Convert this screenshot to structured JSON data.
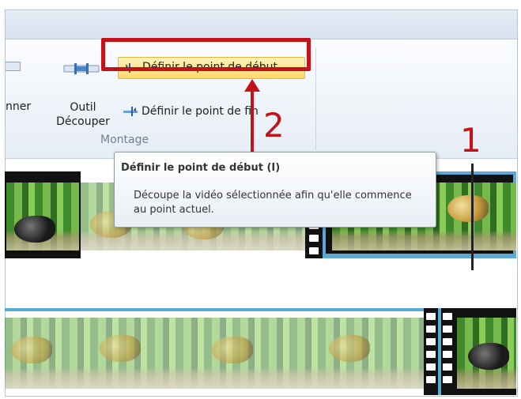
{
  "ribbon": {
    "partial_button_label": "nner",
    "trim_tool_label": "Outil\nDécouper",
    "set_start_label": "Définir le point de début",
    "set_end_label": "Définir le point de fin",
    "group_label": "Montage"
  },
  "tooltip": {
    "title": "Définir le point de début (I)",
    "description": "Découpe la vidéo sélectionnée afin qu'elle commence au point actuel."
  },
  "annotations": {
    "step_1": "1",
    "step_2": "2",
    "highlight_color": "#c4121a"
  },
  "icons": {
    "trim_tool": "trim-tool-icon",
    "set_start": "set-start-point-icon",
    "set_end": "set-end-point-icon"
  }
}
